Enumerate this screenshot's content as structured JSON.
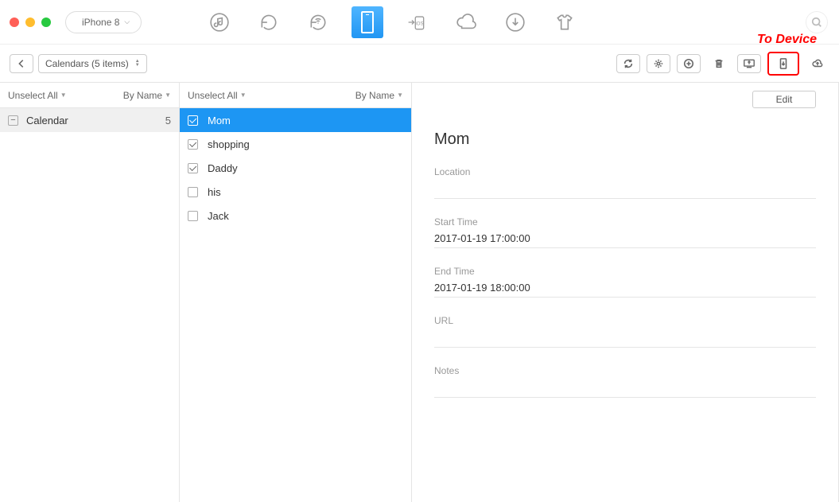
{
  "annotation": "To Device",
  "device": {
    "name": "iPhone 8"
  },
  "breadcrumb": {
    "label": "Calendars (5 items)"
  },
  "col1": {
    "unselect": "Unselect All",
    "sort": "By Name",
    "items": [
      {
        "label": "Calendar",
        "count": "5"
      }
    ]
  },
  "col2": {
    "unselect": "Unselect All",
    "sort": "By Name",
    "items": [
      {
        "label": "Mom",
        "checked": true,
        "selected": true
      },
      {
        "label": "shopping",
        "checked": true,
        "selected": false
      },
      {
        "label": "Daddy",
        "checked": true,
        "selected": false
      },
      {
        "label": "his",
        "checked": false,
        "selected": false
      },
      {
        "label": "Jack",
        "checked": false,
        "selected": false
      }
    ]
  },
  "detail": {
    "edit_label": "Edit",
    "title": "Mom",
    "location_label": "Location",
    "location_value": "",
    "start_label": "Start Time",
    "start_value": "2017-01-19 17:00:00",
    "end_label": "End Time",
    "end_value": "2017-01-19 18:00:00",
    "url_label": "URL",
    "url_value": "",
    "notes_label": "Notes",
    "notes_value": ""
  }
}
